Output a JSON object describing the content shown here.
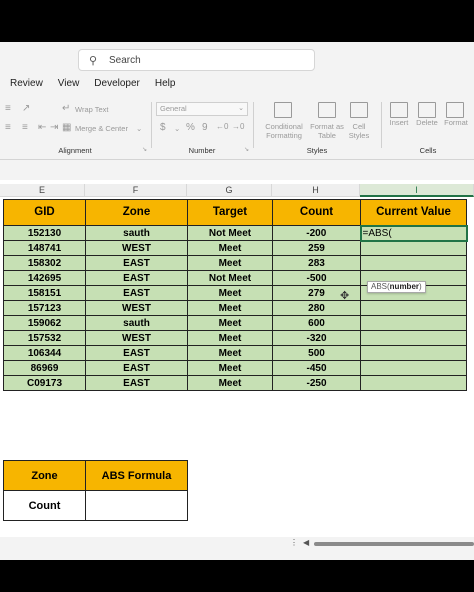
{
  "search": {
    "label": "Search",
    "icon": "search-icon"
  },
  "menu": [
    "Review",
    "View",
    "Developer",
    "Help"
  ],
  "ribbon": {
    "wrap_text": "Wrap Text",
    "merge_center": "Merge & Center",
    "alignment_label": "Alignment",
    "number_format": "General",
    "number_label": "Number",
    "currency": "$",
    "percent": "%",
    "comma": "9",
    "cond_formatting_1": "Conditional",
    "cond_formatting_2": "Formatting",
    "format_table_1": "Format as",
    "format_table_2": "Table",
    "cell_styles_1": "Cell",
    "cell_styles_2": "Styles",
    "styles_label": "Styles",
    "insert": "Insert",
    "delete": "Delete",
    "format": "Format",
    "cells_label": "Cells"
  },
  "columns": [
    "E",
    "F",
    "G",
    "H",
    "I"
  ],
  "table": {
    "headers": [
      "GID",
      "Zone",
      "Target",
      "Count",
      "Current Value"
    ],
    "rows": [
      [
        "152130",
        "sauth",
        "Not Meet",
        "-200"
      ],
      [
        "148741",
        "WEST",
        "Meet",
        "259"
      ],
      [
        "158302",
        "EAST",
        "Meet",
        "283"
      ],
      [
        "142695",
        "EAST",
        "Not Meet",
        "-500"
      ],
      [
        "158151",
        "EAST",
        "Meet",
        "279"
      ],
      [
        "157123",
        "WEST",
        "Meet",
        "280"
      ],
      [
        "159062",
        "sauth",
        "Meet",
        "600"
      ],
      [
        "157532",
        "WEST",
        "Meet",
        "-320"
      ],
      [
        "106344",
        "EAST",
        "Meet",
        "500"
      ],
      [
        "86969",
        "EAST",
        "Meet",
        "-450"
      ],
      [
        "C09173",
        "EAST",
        "Meet",
        "-250"
      ]
    ],
    "active_cell_formula": "=ABS(",
    "tooltip_fn": "ABS(",
    "tooltip_arg": "number",
    "tooltip_close": ")"
  },
  "summary": {
    "headers": [
      "Zone",
      "ABS Formula"
    ],
    "row_label": "Count",
    "row_value": ""
  },
  "colors": {
    "header_fill": "#f7b500",
    "row_fill": "#c6e0b4",
    "selection": "#217346"
  }
}
